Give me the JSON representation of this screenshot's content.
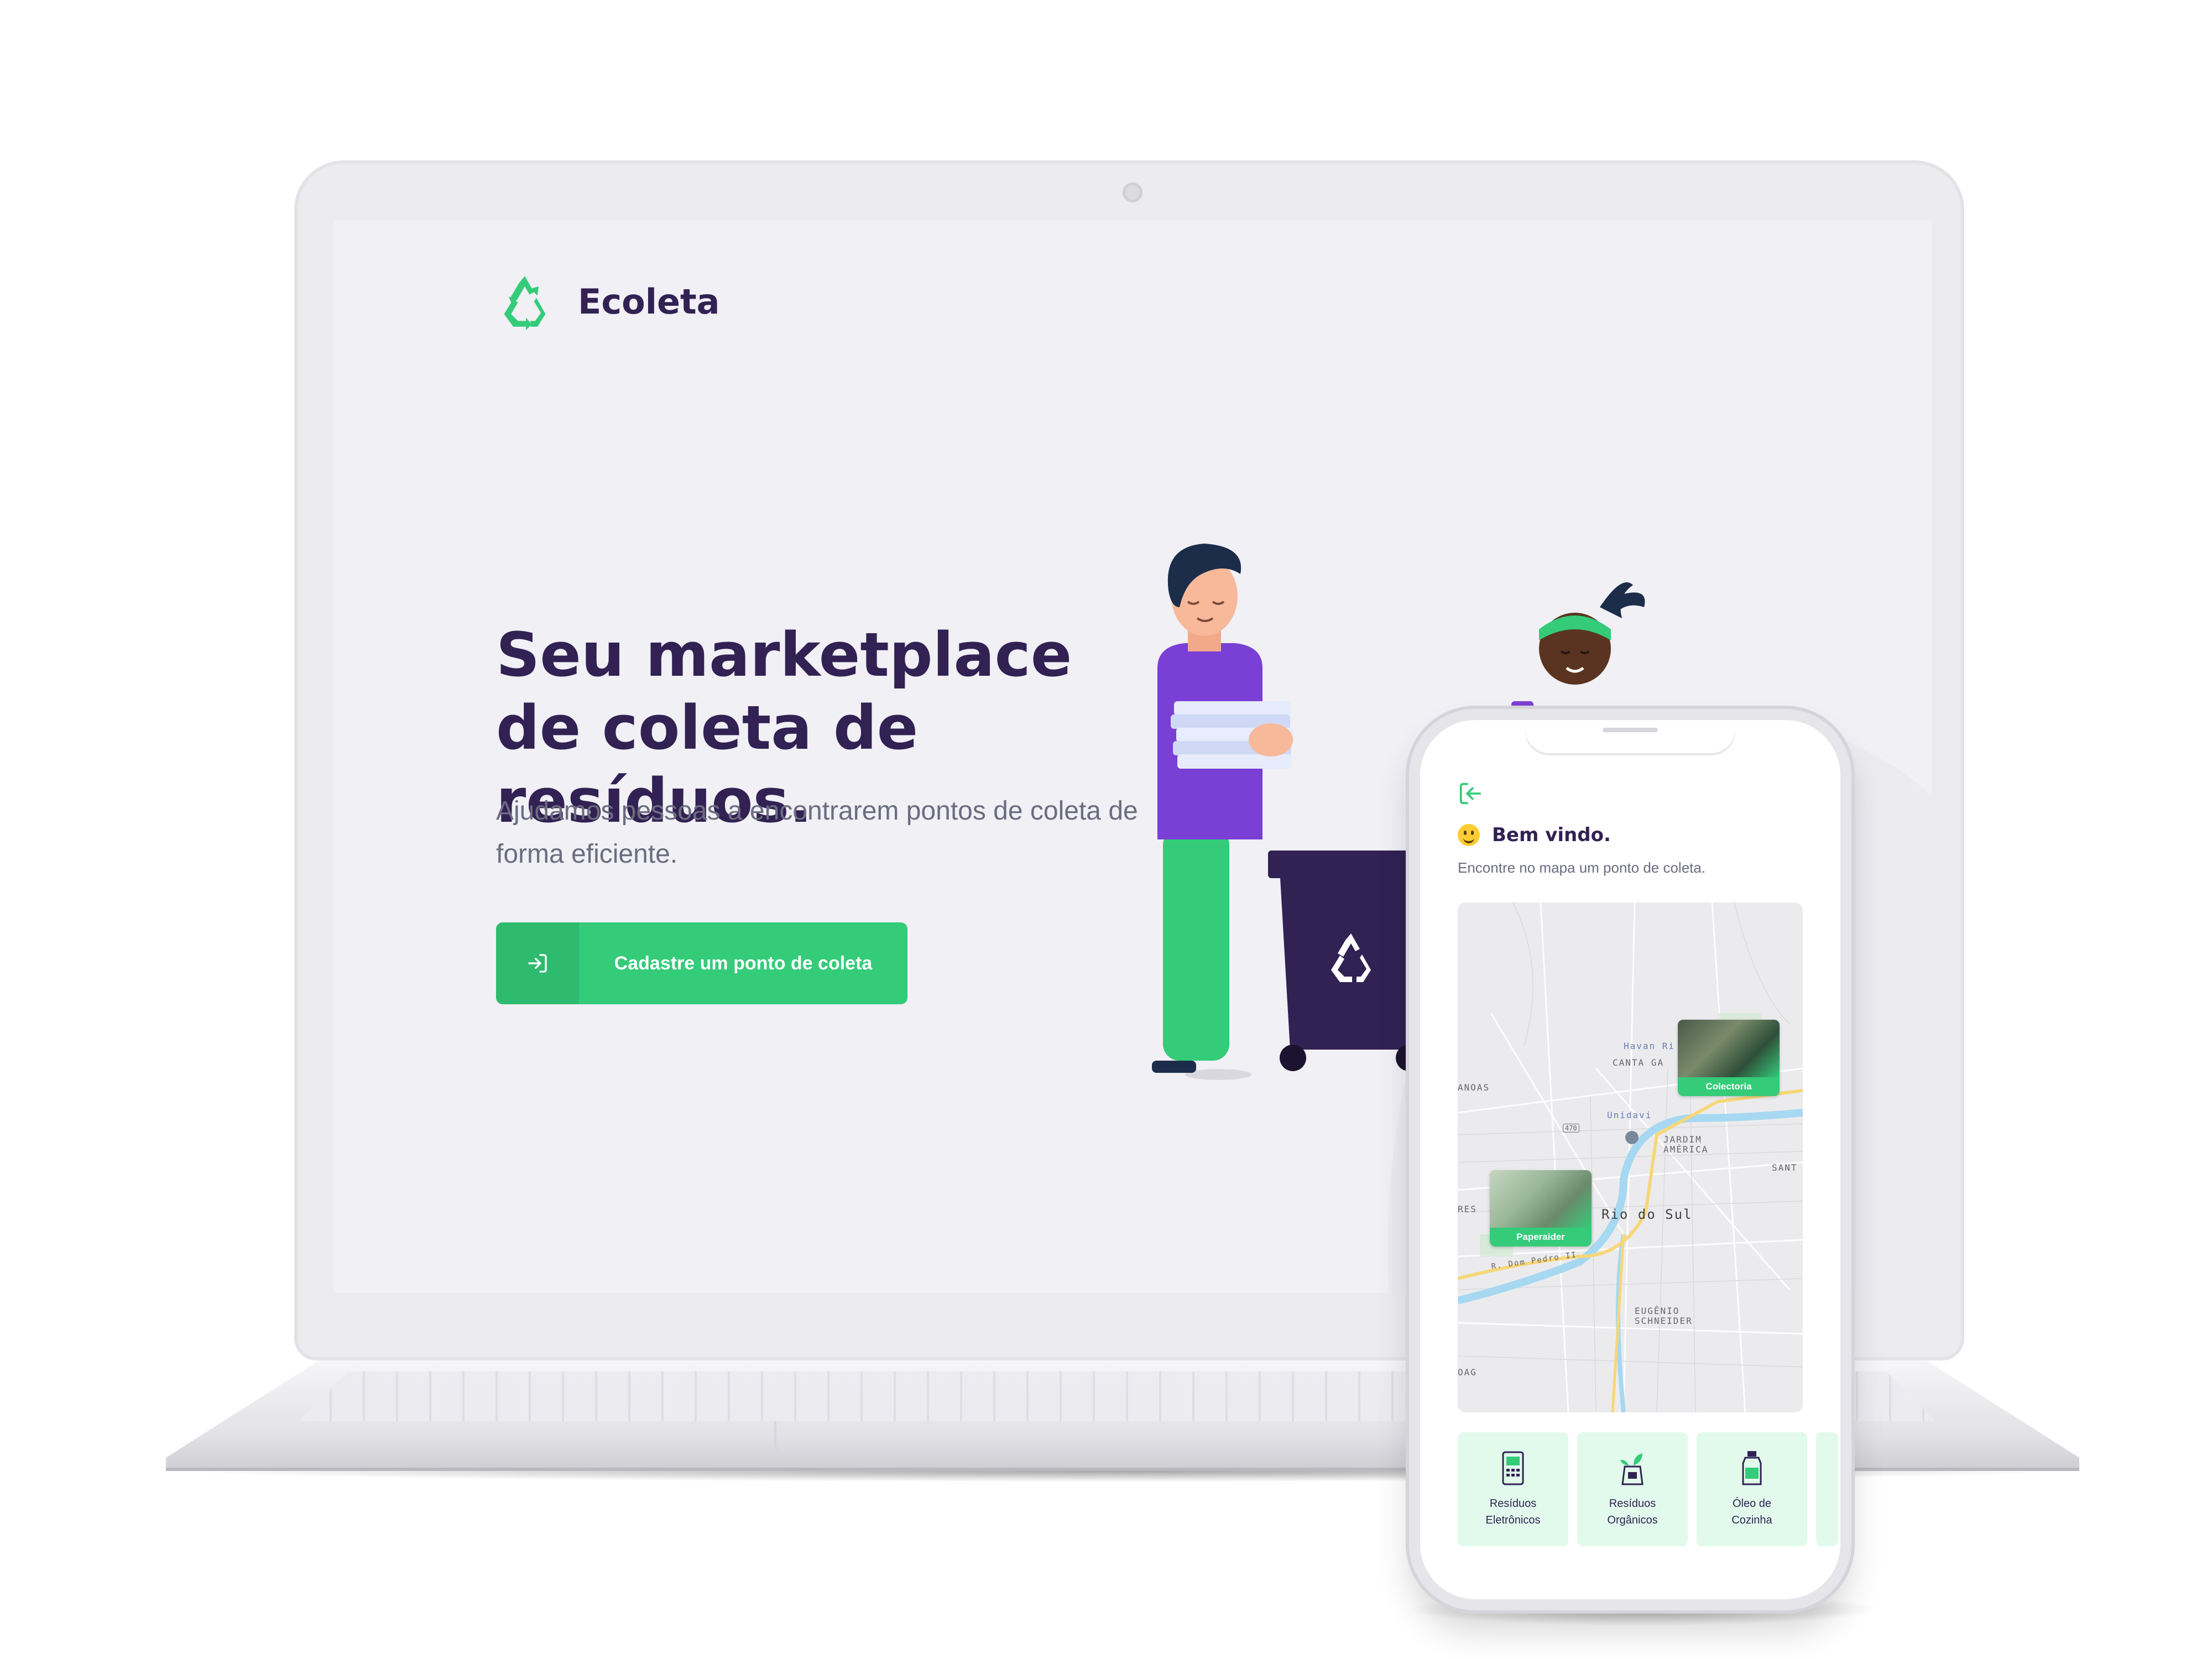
{
  "web": {
    "brand": "Ecoleta",
    "hero_title": "Seu marketplace de coleta de resíduos.",
    "hero_subtitle": "Ajudamos pessoas a encontrarem pontos de coleta de forma eficiente.",
    "cta_label": "Cadastre um ponto de coleta",
    "cta_icon": "log-in-icon",
    "colors": {
      "primary": "#34cb79",
      "title": "#322153",
      "text": "#6c6c80",
      "background": "#f0f0f5"
    }
  },
  "mobile": {
    "back_icon": "log-out-icon",
    "welcome_title": "Bem vindo.",
    "welcome_emoji": "smile-emoji",
    "welcome_subtitle": "Encontre no mapa um ponto de coleta.",
    "map": {
      "markers": [
        {
          "label": "Colectoria"
        },
        {
          "label": "Paperaider"
        }
      ],
      "place_labels": [
        "Rio do Sul",
        "JARDIM AMÉRICA",
        "EUGÊNIO SCHNEIDER",
        "CANTA GA",
        "Havan Ri",
        "Unidavi",
        "R. Dom Pedro II",
        "ANOAS",
        "RES",
        "SANT",
        "OAG",
        "470"
      ]
    },
    "items": [
      {
        "title_line1": "Resíduos",
        "title_line2": "Eletrônicos",
        "icon": "battery-icon"
      },
      {
        "title_line1": "Resíduos",
        "title_line2": "Orgânicos",
        "icon": "compost-icon"
      },
      {
        "title_line1": "Óleo de",
        "title_line2": "Cozinha",
        "icon": "oil-bottle-icon"
      }
    ]
  }
}
